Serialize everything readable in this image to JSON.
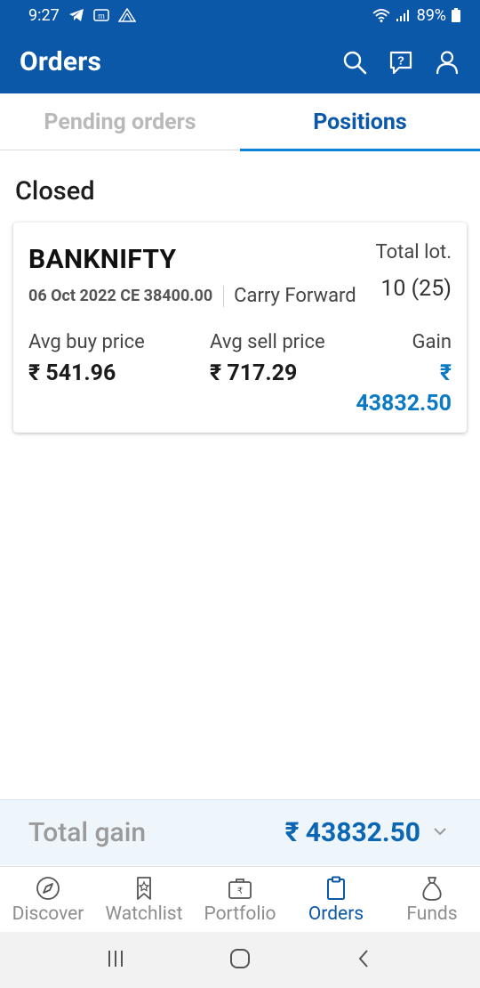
{
  "status_bar": {
    "time": "9:27",
    "battery": "89%",
    "icons": [
      "telegram-icon",
      "mail-app-icon",
      "signal-app-icon",
      "wifi-icon",
      "cell-signal-icon",
      "battery-icon"
    ]
  },
  "header": {
    "title": "Orders",
    "actions": [
      "search-icon",
      "help-icon",
      "profile-icon"
    ]
  },
  "tabs": [
    {
      "label": "Pending orders",
      "active": false
    },
    {
      "label": "Positions",
      "active": true
    }
  ],
  "section": {
    "title": "Closed"
  },
  "position": {
    "symbol": "BANKNIFTY",
    "contract": "06 Oct 2022 CE 38400.00",
    "product": "Carry Forward",
    "total_lot_label": "Total lot.",
    "total_lot_value": "10 (25)",
    "avg_buy_label": "Avg buy price",
    "avg_buy_value": "₹ 541.96",
    "avg_sell_label": "Avg sell price",
    "avg_sell_value": "₹ 717.29",
    "gain_label": "Gain",
    "gain_currency": "₹",
    "gain_value": "43832.50"
  },
  "footer": {
    "total_label": "Total gain",
    "total_value": "₹ 43832.50"
  },
  "bottom_nav": [
    {
      "label": "Discover",
      "icon": "compass-icon",
      "active": false
    },
    {
      "label": "Watchlist",
      "icon": "bookmark-icon",
      "active": false
    },
    {
      "label": "Portfolio",
      "icon": "briefcase-icon",
      "active": false
    },
    {
      "label": "Orders",
      "icon": "clipboard-icon",
      "active": true
    },
    {
      "label": "Funds",
      "icon": "money-bag-icon",
      "active": false
    }
  ],
  "colors": {
    "brand": "#0b57a8",
    "accent": "#0b84d8",
    "gain": "#0b7ac4"
  }
}
